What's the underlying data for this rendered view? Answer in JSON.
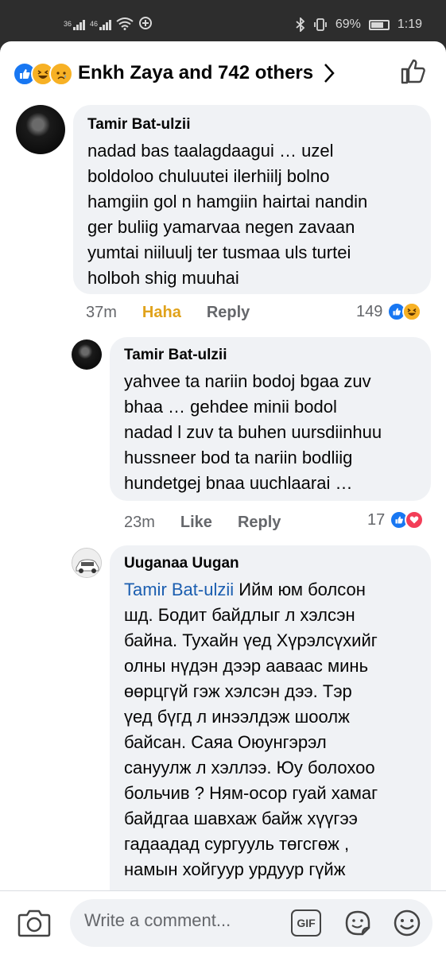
{
  "status_bar": {
    "signal_1": "36",
    "signal_2": "46",
    "battery": "69%",
    "time": "1:19"
  },
  "header": {
    "text": "Enkh Zaya and 742 others",
    "reaction_icons": [
      "like-icon",
      "haha-icon",
      "sad-icon"
    ]
  },
  "comments": [
    {
      "author": "Tamir Bat-ulzii",
      "lines": [
        "nadad bas taalagdaagui … uzel",
        "boldoloo chuluutei ilerhiilj bolno",
        "hamgiin gol n hamgiin hairtai nandin",
        "ger buliig yamarvaa negen zavaan",
        "yumtai niiluulj ter tusmaa uls turtei",
        "holboh shig muuhai"
      ],
      "time": "37m",
      "react_label": "Haha",
      "reply_label": "Reply",
      "reaction_count": "149",
      "reactions": [
        "like-icon",
        "haha-icon"
      ]
    },
    {
      "author": "Tamir Bat-ulzii",
      "lines": [
        "yahvee ta nariin bodoj bgaa zuv",
        "bhaa … gehdee minii bodol",
        "nadad l zuv ta buhen uursdiinhuu",
        "hussneer bod ta nariin bodliig",
        "hundetgej bnaa uuchlaarai …"
      ],
      "time": "23m",
      "react_label": "Like",
      "reply_label": "Reply",
      "reaction_count": "17",
      "reactions": [
        "like-icon",
        "love-icon"
      ]
    },
    {
      "author": "Uuganaa Uugan",
      "mention": "Tamir Bat-ulzii",
      "lines": [
        " Ийм юм болсон",
        "шд. Бодит байдлыг л хэлсэн",
        "байна. Тухайн үед Хүрэлсүхийг",
        "олны нүдэн дээр аавaас минь",
        "өөрцгүй гэж хэлсэн дээ. Тэр",
        "үед бүгд л инээлдэж шоолж",
        "байсан. Саяа Оюунгэрэл",
        "сануулж л хэллээ. Юу болохоо",
        "больчив ? Ням-осор гуай хамаг",
        "байдгаа шавхаж байж хүүгээ",
        "гадаадад сургууль төгсгөж ,",
        "намын хойгуур урдуур гүйж"
      ]
    }
  ],
  "composer": {
    "placeholder": "Write a comment...",
    "gif_label": "GIF"
  }
}
